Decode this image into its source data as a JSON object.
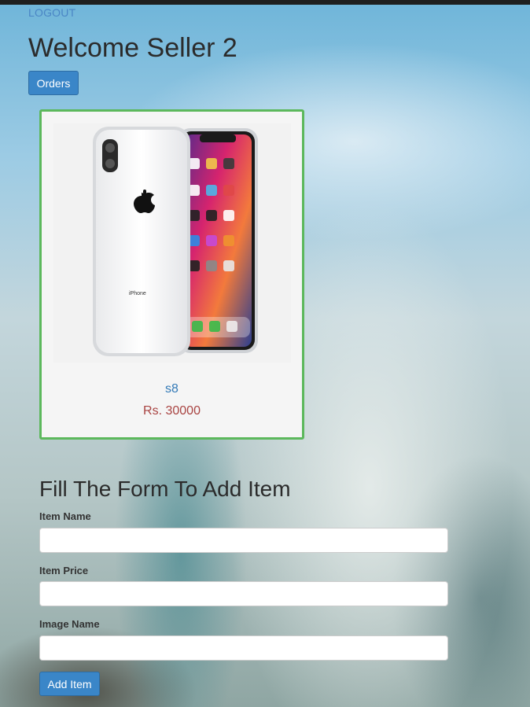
{
  "header": {
    "logout_label": "LOGOUT",
    "welcome_text": "Welcome Seller 2",
    "orders_label": "Orders"
  },
  "products": [
    {
      "name": "s8",
      "price": "Rs. 30000",
      "image_caption": "iPhone"
    }
  ],
  "form": {
    "title": "Fill The Form To Add Item",
    "item_name_label": "Item Name",
    "item_name_value": "",
    "item_price_label": "Item Price",
    "item_price_value": "",
    "image_name_label": "Image Name",
    "image_name_value": "",
    "submit_label": "Add Item"
  },
  "colors": {
    "primary_button": "#3a86c8",
    "card_border": "#5cb85c",
    "price_text": "#a94442",
    "link_text": "#337ab7"
  }
}
